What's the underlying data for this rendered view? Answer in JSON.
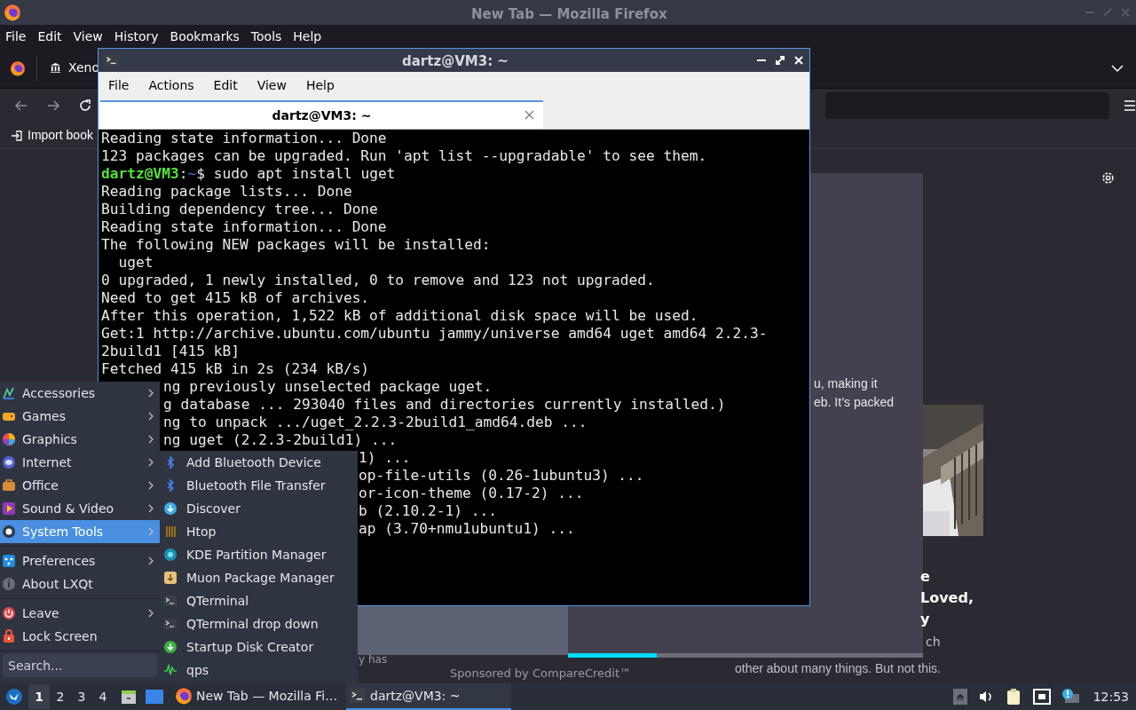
{
  "firefox": {
    "title": "New Tab — Mozilla Firefox",
    "menu": [
      "File",
      "Edit",
      "View",
      "History",
      "Bookmarks",
      "Tools",
      "Help"
    ],
    "tab": {
      "label": "Xeno"
    },
    "bookmark": "Import book",
    "page": {
      "snippets": [
        "u, making it",
        "eb. It’s packed"
      ],
      "headline": [
        "e",
        "Loved,",
        "y"
      ],
      "body": [
        "ch",
        "other about many things. But not this."
      ],
      "left_snippet": "y has",
      "sponsor": "Sponsored by CompareCredit™",
      "carousel": {
        "level": 0.25
      },
      "image": {
        "kind": "picture"
      }
    }
  },
  "terminal": {
    "title": "dartz@VM3: ~",
    "menu": [
      "File",
      "Actions",
      "Edit",
      "View",
      "Help"
    ],
    "tab": {
      "label": "dartz@VM3: ~",
      "selected": true
    },
    "lines": [
      {
        "kind": "full",
        "text": "Reading state information... Done"
      },
      {
        "kind": "full",
        "text": "123 packages can be upgraded. Run 'apt list --upgradable' to see them."
      },
      {
        "kind": "prompt",
        "user": "dartz@VM3",
        "sep": ":",
        "path": "~",
        "text": "$ sudo apt install uget"
      },
      {
        "kind": "full",
        "text": "Reading package lists... Done"
      },
      {
        "kind": "full",
        "text": "Building dependency tree... Done"
      },
      {
        "kind": "full",
        "text": "Reading state information... Done"
      },
      {
        "kind": "full",
        "text": "The following NEW packages will be installed:"
      },
      {
        "kind": "full",
        "text": "  uget"
      },
      {
        "kind": "full",
        "text": "0 upgraded, 1 newly installed, 0 to remove and 123 not upgraded."
      },
      {
        "kind": "full",
        "text": "Need to get 415 kB of archives."
      },
      {
        "kind": "full",
        "text": "After this operation, 1,522 kB of additional disk space will be used."
      },
      {
        "kind": "full",
        "text": "Get:1 http://archive.ubuntu.com/ubuntu jammy/universe amd64 uget amd64 2.2.3-"
      },
      {
        "kind": "full",
        "text": "2build1 [415 kB]"
      },
      {
        "kind": "full",
        "text": "Fetched 415 kB in 2s (234 kB/s)"
      },
      {
        "kind": "behind_menu",
        "text": "ng previously unselected package uget."
      },
      {
        "kind": "behind_menu",
        "text": "g database ... 293040 files and directories currently installed.)"
      },
      {
        "kind": "behind_menu",
        "text": "ng to unpack .../uget_2.2.3-2build1_amd64.deb ..."
      },
      {
        "kind": "behind_menu",
        "text": "ng uget (2.2.3-2build1) ..."
      },
      {
        "kind": "behind_submenu",
        "text": "1) ..."
      },
      {
        "kind": "behind_submenu",
        "text": "op-file-utils (0.26-1ubuntu3) ..."
      },
      {
        "kind": "behind_submenu",
        "text": "or-icon-theme (0.17-2) ..."
      },
      {
        "kind": "behind_submenu",
        "text": "b (2.10.2-1) ..."
      },
      {
        "kind": "behind_submenu",
        "text": "ap (3.70+nmu1ubuntu1) ..."
      }
    ]
  },
  "start_menu": {
    "items": [
      {
        "kind": "item",
        "label": "Accessories",
        "submenu": true,
        "selected": false
      },
      {
        "kind": "item",
        "label": "Games",
        "submenu": true,
        "selected": false
      },
      {
        "kind": "item",
        "label": "Graphics",
        "submenu": true,
        "selected": false
      },
      {
        "kind": "item",
        "label": "Internet",
        "submenu": true,
        "selected": false
      },
      {
        "kind": "item",
        "label": "Office",
        "submenu": true,
        "selected": false
      },
      {
        "kind": "item",
        "label": "Sound & Video",
        "submenu": true,
        "selected": false
      },
      {
        "kind": "item",
        "label": "System Tools",
        "submenu": true,
        "selected": true
      },
      {
        "kind": "separator"
      },
      {
        "kind": "item",
        "label": "Preferences",
        "submenu": true,
        "selected": false
      },
      {
        "kind": "item",
        "label": "About LXQt",
        "submenu": false,
        "selected": false
      },
      {
        "kind": "separator"
      },
      {
        "kind": "item",
        "label": "Leave",
        "submenu": true,
        "selected": false
      },
      {
        "kind": "item",
        "label": "Lock Screen",
        "submenu": false,
        "selected": false
      }
    ],
    "search": {
      "placeholder": "Search..."
    }
  },
  "submenu": {
    "items": [
      "Add Bluetooth Device",
      "Bluetooth File Transfer",
      "Discover",
      "Htop",
      "KDE Partition Manager",
      "Muon Package Manager",
      "QTerminal",
      "QTerminal drop down",
      "Startup Disk Creator",
      "qps"
    ]
  },
  "taskbar": {
    "desktops": [
      {
        "label": "1",
        "selected": true
      },
      {
        "label": "2",
        "selected": false
      },
      {
        "label": "3",
        "selected": false
      },
      {
        "label": "4",
        "selected": false
      }
    ],
    "tasks": [
      {
        "label": "New Tab — Mozilla Fi…",
        "selected": false
      },
      {
        "label": "dartz@VM3: ~",
        "selected": true
      }
    ],
    "clock": "12:53"
  }
}
